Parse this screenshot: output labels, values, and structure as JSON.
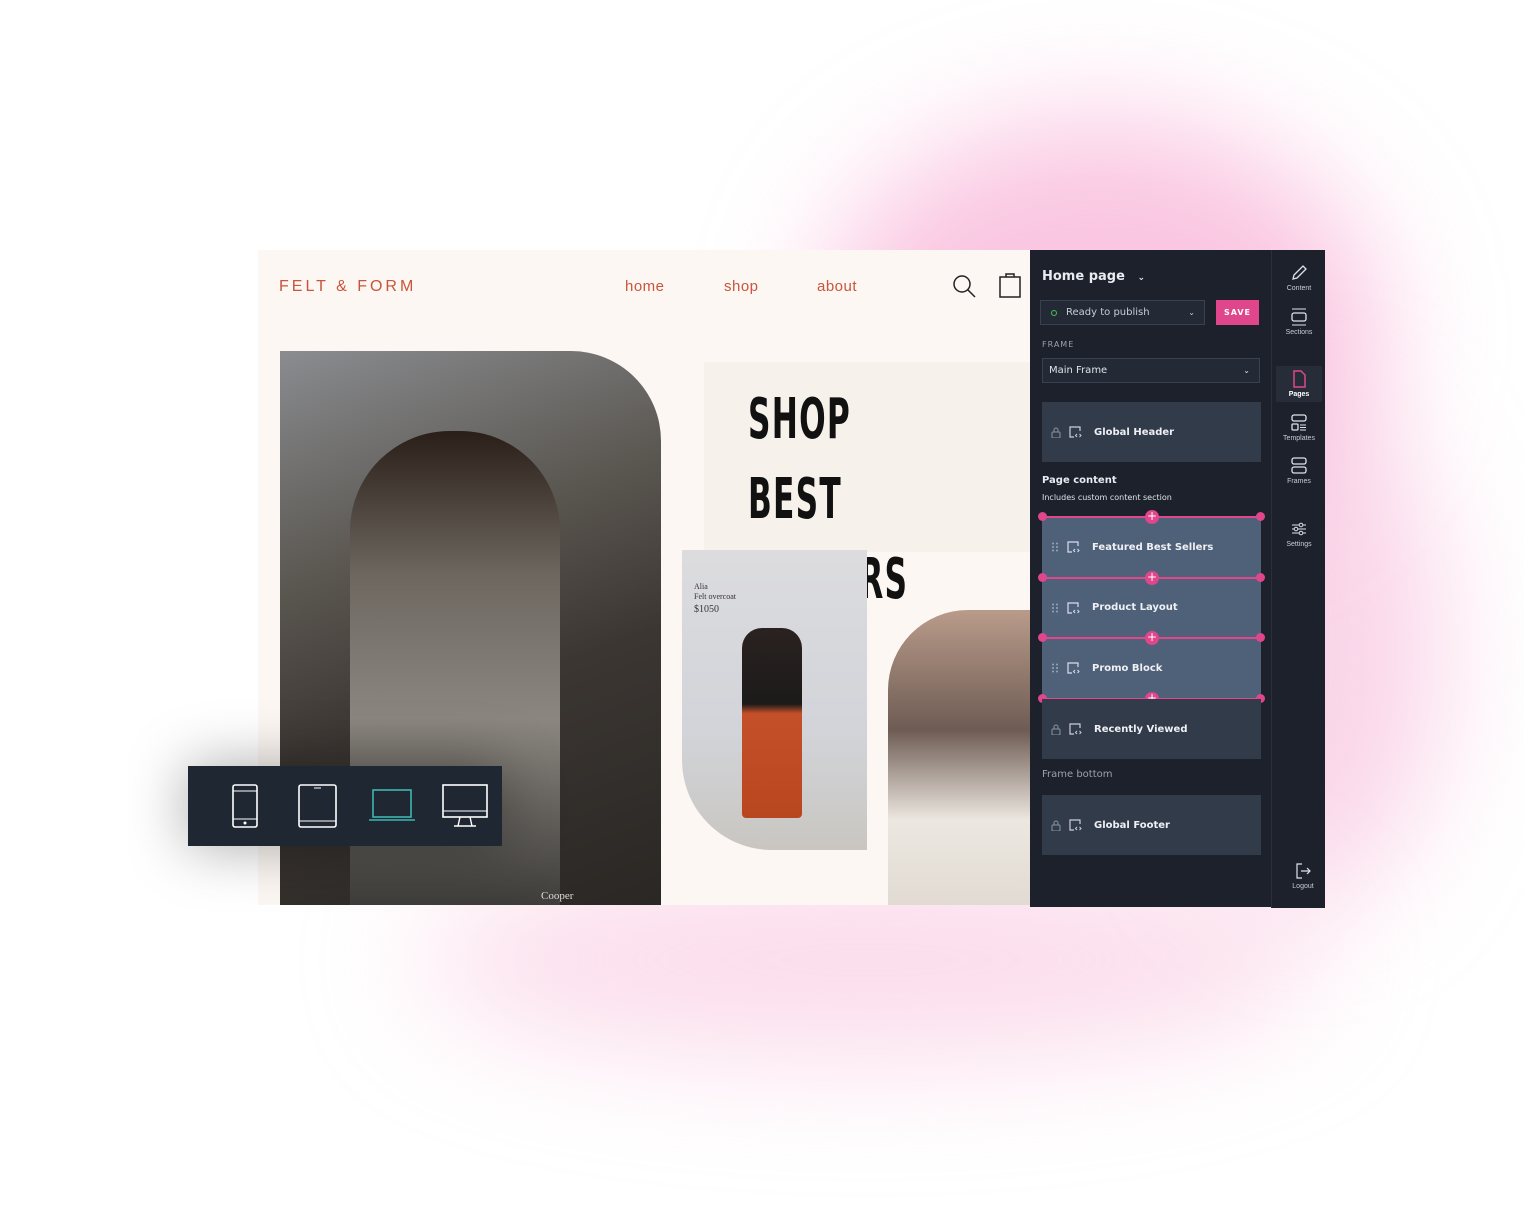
{
  "site": {
    "logo": "FELT & FORM",
    "nav": [
      "home",
      "shop",
      "about"
    ],
    "headline": [
      "SHOP BEST",
      "SELLERS ↓"
    ],
    "product": {
      "name": "Alia",
      "desc": "Felt overcoat",
      "price": "$1050"
    },
    "caption": "Cooper"
  },
  "devices": [
    {
      "icon": "phone-icon"
    },
    {
      "icon": "tablet-icon"
    },
    {
      "icon": "laptop-icon",
      "active": true
    },
    {
      "icon": "desktop-icon"
    }
  ],
  "panel": {
    "title": "Home page",
    "status": "Ready to publish",
    "save": "SAVE",
    "frame_label": "FRAME",
    "frame_value": "Main Frame",
    "header_block": "Global Header",
    "page_content": "Page content",
    "page_content_sub": "Includes custom content section",
    "blocks": [
      "Featured Best Sellers",
      "Product Layout",
      "Promo Block"
    ],
    "locked_block": "Recently Viewed",
    "frame_bottom": "Frame bottom",
    "footer_block": "Global Footer"
  },
  "rail": {
    "items": [
      "Content",
      "Sections",
      "Pages",
      "Templates",
      "Frames",
      "Settings"
    ],
    "logout": "Logout",
    "active": "Pages"
  },
  "colors": {
    "accent": "#e0468c",
    "brand": "#c9553a",
    "panel": "#1c212b",
    "active_device": "#3fb6b0"
  }
}
